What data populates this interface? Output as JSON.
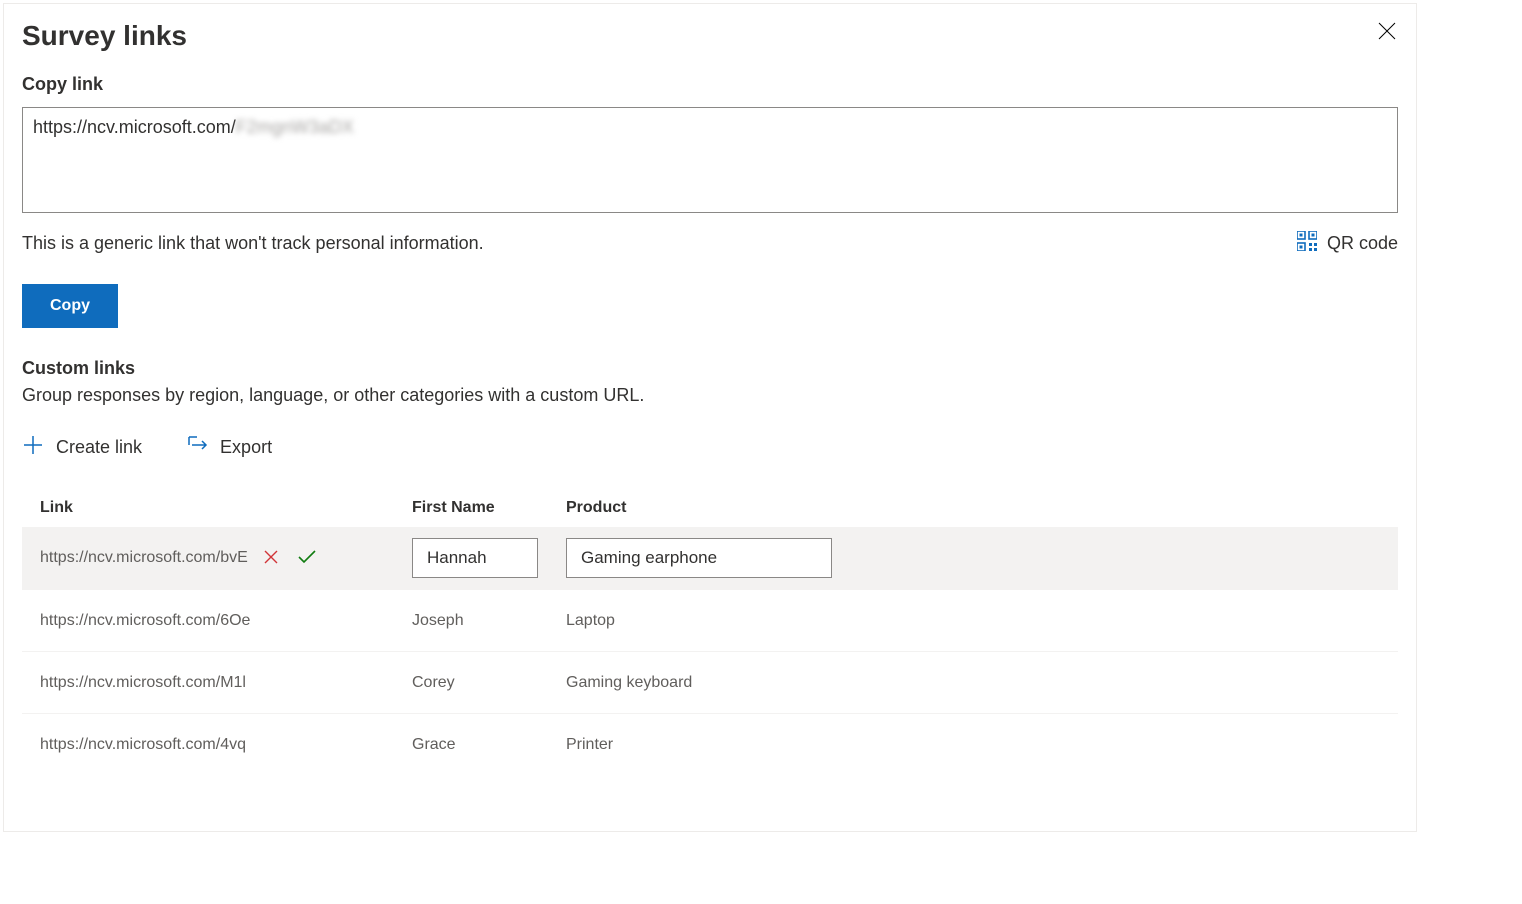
{
  "header": {
    "title": "Survey links"
  },
  "copyLink": {
    "sectionTitle": "Copy link",
    "urlVisible": "https://ncv.microsoft.com/",
    "description": "This is a generic link that won't track personal information.",
    "qrLabel": "QR code",
    "copyButton": "Copy"
  },
  "customLinks": {
    "title": "Custom links",
    "description": "Group responses by region, language, or other categories with a custom URL.",
    "createLink": "Create link",
    "export": "Export",
    "columns": {
      "link": "Link",
      "firstName": "First Name",
      "product": "Product"
    },
    "rows": [
      {
        "link": "https://ncv.microsoft.com/bvE",
        "firstName": "Hannah",
        "product": "Gaming earphone",
        "editing": true
      },
      {
        "link": "https://ncv.microsoft.com/6Oe",
        "firstName": "Joseph",
        "product": "Laptop",
        "editing": false
      },
      {
        "link": "https://ncv.microsoft.com/M1l",
        "firstName": "Corey",
        "product": "Gaming keyboard",
        "editing": false
      },
      {
        "link": "https://ncv.microsoft.com/4vq",
        "firstName": "Grace",
        "product": "Printer",
        "editing": false
      }
    ]
  },
  "colors": {
    "primary": "#0f6cbd",
    "danger": "#d13438",
    "success": "#107c10"
  }
}
